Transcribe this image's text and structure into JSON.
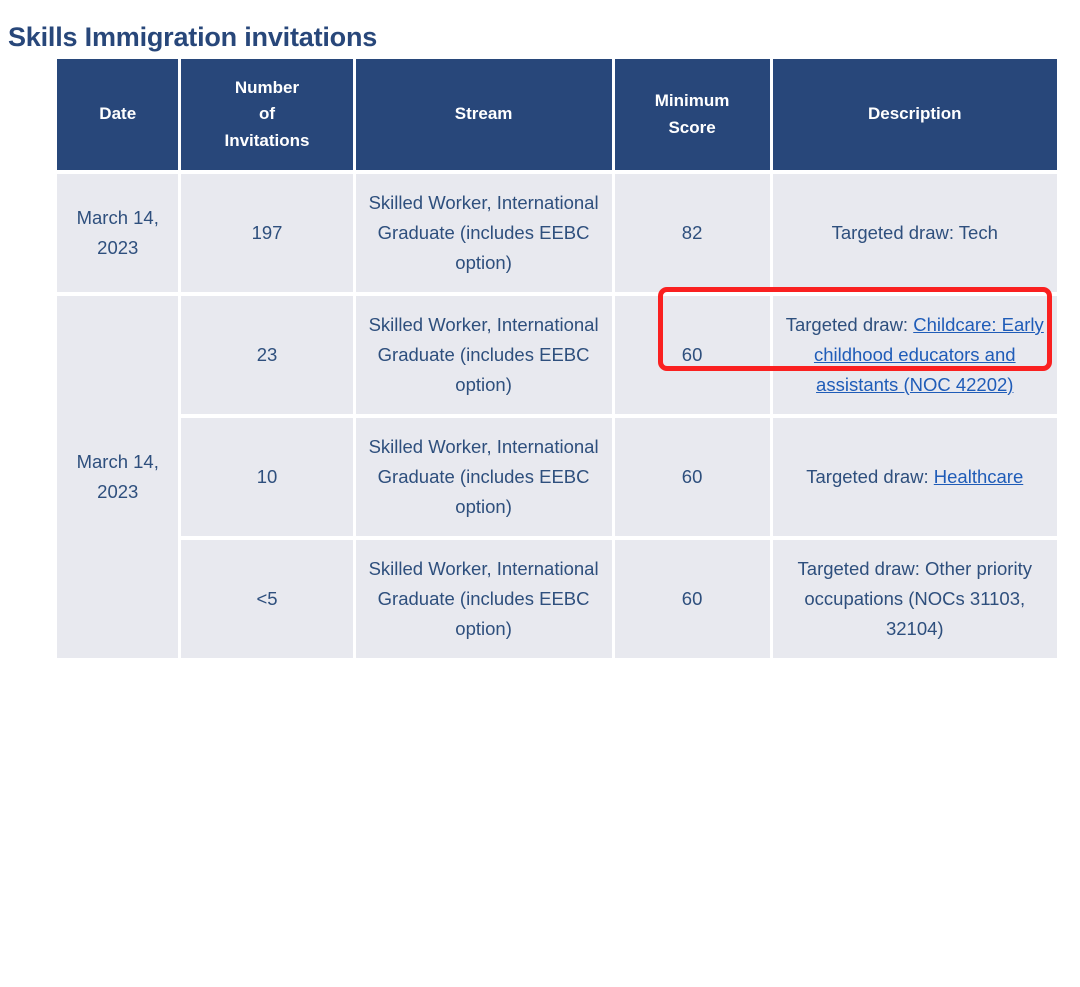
{
  "page": {
    "title": "Skills Immigration invitations"
  },
  "table": {
    "columns": [
      {
        "key": "date",
        "label": "Date"
      },
      {
        "key": "number",
        "label": "Number of Invitations"
      },
      {
        "key": "stream",
        "label": "Stream"
      },
      {
        "key": "score",
        "label": "Minimum Score"
      },
      {
        "key": "desc",
        "label": "Description"
      }
    ],
    "header_lines": {
      "date": [
        "Date"
      ],
      "number": [
        "Number",
        "of",
        "Invitations"
      ],
      "stream": [
        "Stream"
      ],
      "score": [
        "Minimum",
        "Score"
      ],
      "desc": [
        "Description"
      ]
    },
    "rows": [
      {
        "date": "March 14, 2023",
        "date_rowspan": 1,
        "number": "197",
        "stream": "Skilled Worker, International Graduate (includes EEBC option)",
        "score": "82",
        "desc_prefix": "Targeted draw: Tech",
        "desc_link": "",
        "desc_suffix": ""
      },
      {
        "date": "March 14, 2023",
        "date_rowspan": 3,
        "number": "23",
        "stream": "Skilled Worker, International Graduate (includes EEBC option)",
        "score": "60",
        "desc_prefix": "Targeted draw: ",
        "desc_link": "Childcare: Early childhood educators and assistants (NOC 42202)",
        "desc_suffix": ""
      },
      {
        "date": "",
        "date_rowspan": 0,
        "number": "10",
        "stream": "Skilled Worker, International Graduate (includes EEBC option)",
        "score": "60",
        "desc_prefix": "Targeted draw: ",
        "desc_link": "Healthcare",
        "desc_suffix": ""
      },
      {
        "date": "",
        "date_rowspan": 0,
        "number": "<5",
        "stream": "Skilled Worker, International Graduate (includes EEBC option)",
        "score": "60",
        "desc_prefix": "Targeted draw: Other priority occupations (NOCs 31103, 32104)",
        "desc_link": "",
        "desc_suffix": ""
      }
    ]
  },
  "annotation": {
    "type": "highlight-rectangle",
    "color": "#fa2020",
    "targets": [
      "row-1-minimum-score",
      "row-1-description"
    ]
  },
  "colors": {
    "header_background": "#28477a",
    "cell_background": "#e8e9ef",
    "text": "#2e4f7d",
    "link": "#1f5cb8",
    "title": "#28477a",
    "highlight": "#fa2020"
  }
}
